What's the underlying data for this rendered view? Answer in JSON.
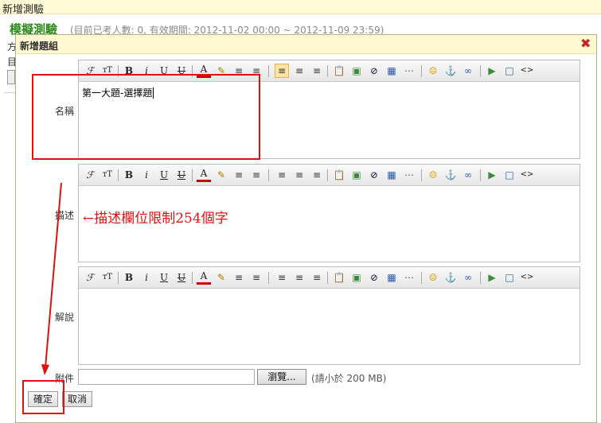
{
  "page": {
    "header_title": "新增測驗",
    "test_title": "模擬測驗",
    "test_info": "(目前已考人數: 0, 有效期間: 2012-11-02 00:00 ~ 2012-11-09 23:59)",
    "frag1": "方",
    "frag2": "目"
  },
  "dialog": {
    "title": "新增題組",
    "close_symbol": "✖",
    "fields": {
      "name_label": "名稱",
      "name_value": "第一大題-選擇題",
      "desc_label": "描述",
      "desc_value": "",
      "explain_label": "解說",
      "explain_value": "",
      "attach_label": "附件",
      "attach_value": ""
    },
    "browse_label": "瀏覽...",
    "file_hint": "(請小於 200 MB)",
    "confirm_label": "確定",
    "cancel_label": "取消"
  },
  "toolbar": {
    "font": "ℱ",
    "size": "тT",
    "bold": "B",
    "italic": "i",
    "underline": "U",
    "strike": "U",
    "color": "A",
    "highlight": "✎",
    "ordered_list": "≡",
    "unordered_list": "≡",
    "align_left": "≡",
    "align_center": "≡",
    "align_right": "≡",
    "paste": "📋",
    "image": "▣",
    "media": "⊘",
    "table": "▦",
    "grid": "⋯",
    "emoji": "☺",
    "anchor": "⚓",
    "link": "∞",
    "new_doc": "▶",
    "fullscreen": "□",
    "source": "<>"
  },
  "annotation": {
    "desc_note": "←描述欄位限制254個字"
  },
  "colors": {
    "title_green": "#2a8a16",
    "annotation_red": "#e01010"
  }
}
